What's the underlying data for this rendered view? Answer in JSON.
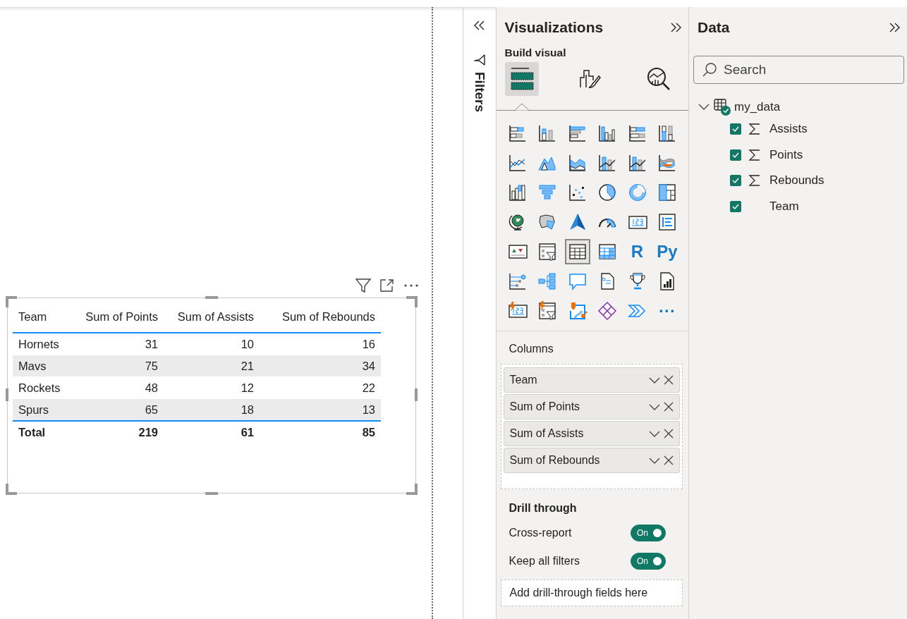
{
  "visual": {
    "header_icons": [
      {
        "kind": "filter"
      },
      {
        "kind": "focus"
      },
      {
        "kind": "more"
      }
    ],
    "table": {
      "columns": [
        "Team",
        "Sum of Points",
        "Sum of Assists",
        "Sum of Rebounds"
      ],
      "rows": [
        [
          "Hornets",
          "31",
          "10",
          "16"
        ],
        [
          "Mavs",
          "75",
          "21",
          "34"
        ],
        [
          "Rockets",
          "48",
          "12",
          "22"
        ],
        [
          "Spurs",
          "65",
          "18",
          "13"
        ]
      ],
      "total": [
        "Total",
        "219",
        "61",
        "85"
      ]
    }
  },
  "filters_pane": {
    "title": "Filters"
  },
  "visualizations_pane": {
    "title": "Visualizations",
    "subtitle": "Build visual",
    "build_tabs": [
      {
        "kind": "fields",
        "selected": true
      },
      {
        "kind": "format",
        "selected": false
      },
      {
        "kind": "analytics",
        "selected": false
      }
    ],
    "visual_types": [
      {
        "kind": "stacked-bar",
        "selected": false
      },
      {
        "kind": "stacked-column",
        "selected": false
      },
      {
        "kind": "clustered-bar",
        "selected": false
      },
      {
        "kind": "clustered-column",
        "selected": false
      },
      {
        "kind": "percent-bar",
        "selected": false
      },
      {
        "kind": "percent-column",
        "selected": false
      },
      {
        "kind": "line",
        "selected": false
      },
      {
        "kind": "area",
        "selected": false
      },
      {
        "kind": "stacked-area",
        "selected": false
      },
      {
        "kind": "line-column",
        "selected": false
      },
      {
        "kind": "line-stacked-column",
        "selected": false
      },
      {
        "kind": "ribbon",
        "selected": false
      },
      {
        "kind": "waterfall",
        "selected": false
      },
      {
        "kind": "funnel",
        "selected": false
      },
      {
        "kind": "scatter",
        "selected": false
      },
      {
        "kind": "pie",
        "selected": false
      },
      {
        "kind": "donut",
        "selected": false
      },
      {
        "kind": "treemap",
        "selected": false
      },
      {
        "kind": "globe",
        "selected": false
      },
      {
        "kind": "filled-map",
        "selected": false
      },
      {
        "kind": "arrow",
        "selected": false
      },
      {
        "kind": "gauge",
        "selected": false
      },
      {
        "kind": "card",
        "selected": false
      },
      {
        "kind": "multi-card",
        "selected": false
      },
      {
        "kind": "kpi",
        "selected": false
      },
      {
        "kind": "slicer",
        "selected": false
      },
      {
        "kind": "table",
        "selected": true
      },
      {
        "kind": "matrix",
        "selected": false
      },
      {
        "kind": "text",
        "label": "R",
        "selected": false
      },
      {
        "kind": "text",
        "label": "Py",
        "selected": false
      },
      {
        "kind": "influencers",
        "selected": false
      },
      {
        "kind": "decomposition",
        "selected": false
      },
      {
        "kind": "speech",
        "selected": false
      },
      {
        "kind": "document",
        "selected": false
      },
      {
        "kind": "trophy",
        "selected": false
      },
      {
        "kind": "report",
        "selected": false
      },
      {
        "kind": "lightning-card",
        "selected": false
      },
      {
        "kind": "lightning-slicer",
        "selected": false
      },
      {
        "kind": "map-pin",
        "selected": false
      },
      {
        "kind": "diamond",
        "selected": false
      },
      {
        "kind": "chevron",
        "selected": false
      },
      {
        "kind": "text",
        "label": "···",
        "selected": false
      }
    ],
    "columns_label": "Columns",
    "column_fields": [
      "Team",
      "Sum of Points",
      "Sum of Assists",
      "Sum of Rebounds"
    ],
    "drill_title": "Drill through",
    "toggles": [
      {
        "label": "Cross-report",
        "on": true,
        "state_label": "On"
      },
      {
        "label": "Keep all filters",
        "on": true,
        "state_label": "On"
      }
    ],
    "drop_hint": "Add drill-through fields here"
  },
  "data_pane": {
    "title": "Data",
    "search": {
      "placeholder": "Search"
    },
    "tables": [
      {
        "name": "my_data",
        "expanded": true,
        "children": [
          {
            "name": "Assists",
            "kind": "measure",
            "checked": true
          },
          {
            "name": "Points",
            "kind": "measure",
            "checked": true
          },
          {
            "name": "Rebounds",
            "kind": "measure",
            "checked": true
          },
          {
            "name": "Team",
            "kind": "text",
            "checked": true
          }
        ]
      }
    ]
  }
}
